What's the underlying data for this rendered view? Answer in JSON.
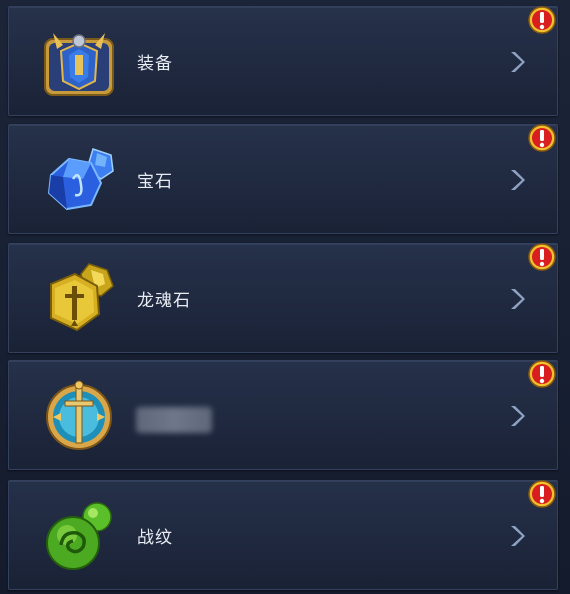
{
  "menu": {
    "items": [
      {
        "label": "装备",
        "icon": "armor-icon",
        "has_alert": true
      },
      {
        "label": "宝石",
        "icon": "gem-icon",
        "has_alert": true
      },
      {
        "label": "龙魂石",
        "icon": "dragon-soul-stone-icon",
        "has_alert": true
      },
      {
        "label": "",
        "icon": "sword-emblem-icon",
        "has_alert": true,
        "label_obscured": true
      },
      {
        "label": "战纹",
        "icon": "battle-pattern-icon",
        "has_alert": true
      }
    ]
  },
  "colors": {
    "alert_red": "#d81e1e",
    "alert_gold": "#f2c12e",
    "chevron": "#8fa2c4",
    "label": "#e8ecf4"
  }
}
